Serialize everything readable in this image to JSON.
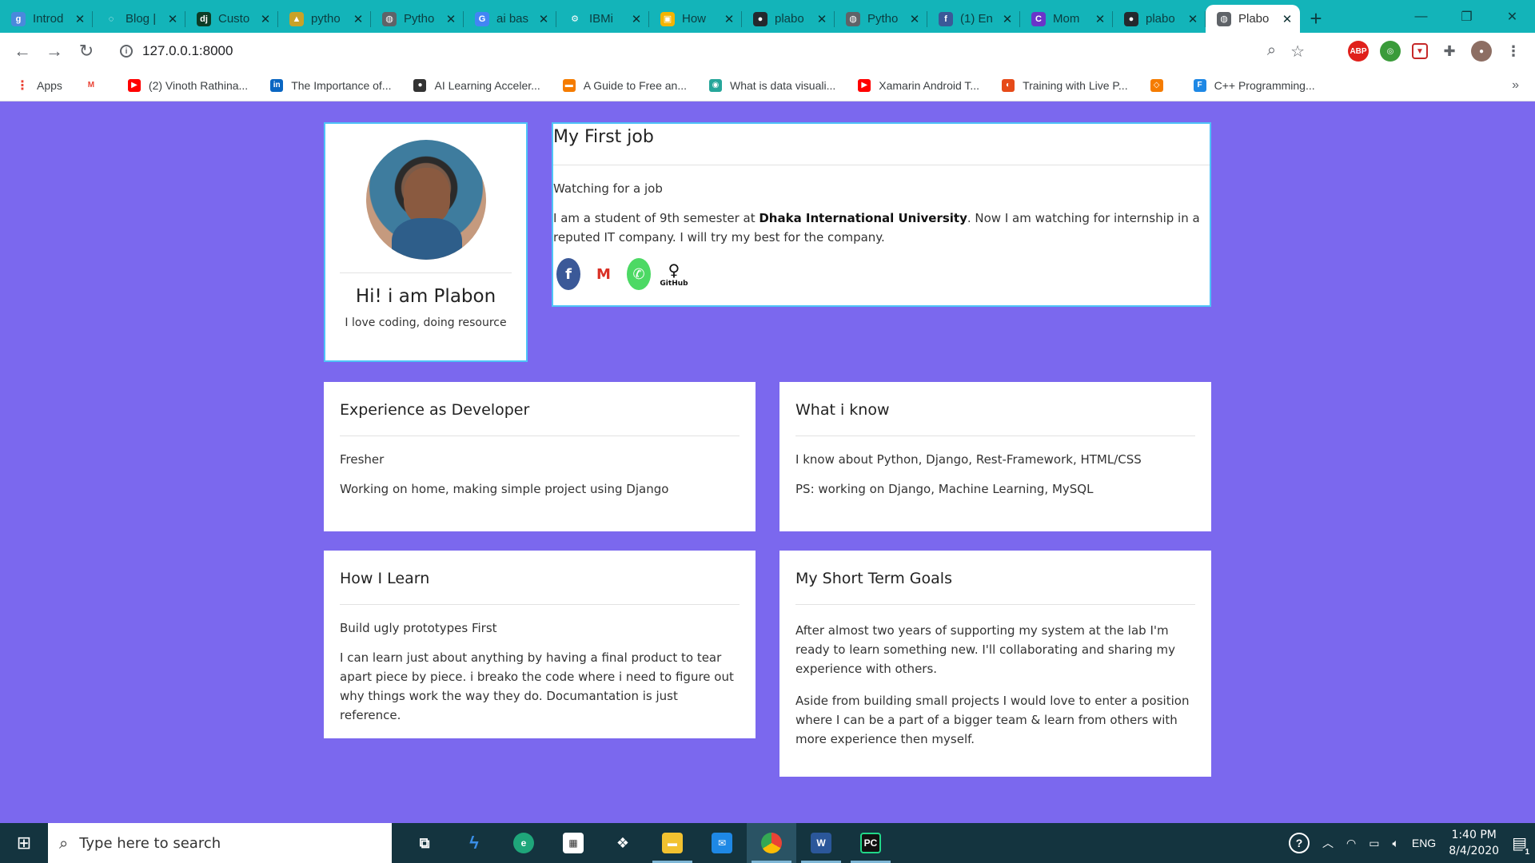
{
  "browser": {
    "tabs": [
      {
        "label": "Introd",
        "color": "#4a89dc",
        "glyph": "g"
      },
      {
        "label": "Blog |",
        "color": "#13b4b9",
        "glyph": "◌"
      },
      {
        "label": "Custo",
        "color": "#0c3c26",
        "glyph": "dj"
      },
      {
        "label": "pytho",
        "color": "#c9a227",
        "glyph": "▲"
      },
      {
        "label": "Pytho",
        "color": "#5f6368",
        "glyph": "◍"
      },
      {
        "label": "ai bas",
        "color": "#4285f4",
        "glyph": "G"
      },
      {
        "label": "IBMi",
        "color": "#13b4b9",
        "glyph": "⚙"
      },
      {
        "label": "How",
        "color": "#f4b400",
        "glyph": "▣"
      },
      {
        "label": "plabo",
        "color": "#24292e",
        "glyph": "●"
      },
      {
        "label": "Pytho",
        "color": "#5f6368",
        "glyph": "◍"
      },
      {
        "label": "(1) En",
        "color": "#3b5998",
        "glyph": "f"
      },
      {
        "label": "Mom",
        "color": "#6a35c9",
        "glyph": "C"
      },
      {
        "label": "plabo",
        "color": "#24292e",
        "glyph": "●"
      },
      {
        "label": "Plabo",
        "color": "#5f6368",
        "glyph": "◍"
      }
    ],
    "url": "127.0.0.1:8000",
    "bookmarks": [
      {
        "label": "Apps",
        "color": "#ea4335",
        "glyph": "⋮"
      },
      {
        "label": "",
        "color": "#ffffff",
        "glyph": "M"
      },
      {
        "label": "(2) Vinoth Rathina...",
        "color": "#ff0000",
        "glyph": "▶"
      },
      {
        "label": "The Importance of...",
        "color": "#0a66c2",
        "glyph": "in"
      },
      {
        "label": "AI Learning Acceler...",
        "color": "#333333",
        "glyph": "●"
      },
      {
        "label": "A Guide to Free an...",
        "color": "#f57c00",
        "glyph": "▬"
      },
      {
        "label": "What is data visuali...",
        "color": "#26a69a",
        "glyph": "◉"
      },
      {
        "label": "Xamarin Android T...",
        "color": "#ff0000",
        "glyph": "▶"
      },
      {
        "label": "Training with Live P...",
        "color": "#e64a19",
        "glyph": "◐"
      },
      {
        "label": "",
        "color": "#f57c00",
        "glyph": "◇"
      },
      {
        "label": "C++ Programming...",
        "color": "#1e88e5",
        "glyph": "F"
      }
    ]
  },
  "profile": {
    "name": "Hi! i am Plabon",
    "tagline": "I love coding, doing resource"
  },
  "first_job": {
    "title": "My First job",
    "subtitle": "Watching for a job",
    "desc_before": "I am a student of 9th semester at ",
    "desc_bold": "Dhaka International University",
    "desc_after": ". Now I am watching for internship in a reputed IT company. I will try my best for the company.",
    "socials": [
      "facebook-icon",
      "gmail-icon",
      "phone-icon",
      "github-icon"
    ]
  },
  "experience": {
    "title": "Experience as Developer",
    "lead": "Fresher",
    "body": "Working on home, making simple project using Django"
  },
  "know": {
    "title": "What i know",
    "lead": "I know about Python, Django, Rest-Framework, HTML/CSS",
    "body": "PS: working on Django, Machine Learning, MySQL"
  },
  "learn": {
    "title": "How I Learn",
    "lead": "Build ugly prototypes First",
    "body": "I can learn just about anything by having a final product to tear apart piece by piece. i breako the code where i need to figure out why things work the way they do. Documantation is just reference."
  },
  "goals": {
    "title": "My Short Term Goals",
    "lead": "After almost two years of supporting my system at the lab I'm ready to learn something new. I'll collaborating and sharing my experience with others.",
    "body": "Aside from building small projects I would love to enter a position where I can be a part of a bigger team & learn from others with more experience then myself."
  },
  "taskbar": {
    "search_placeholder": "Type here to search",
    "language": "ENG",
    "time": "1:40 PM",
    "date": "8/4/2020",
    "notification_count": "1"
  }
}
